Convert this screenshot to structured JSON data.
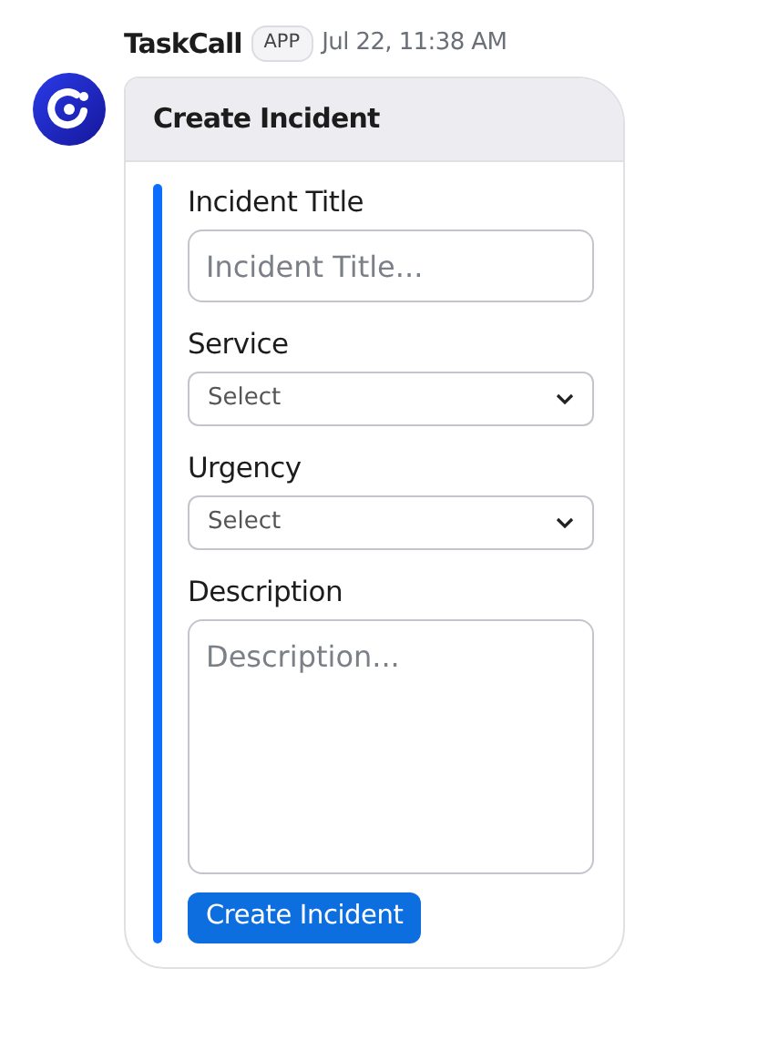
{
  "message": {
    "sender": "TaskCall",
    "badge": "APP",
    "time": "Jul 22, 11:38 AM"
  },
  "card": {
    "title": "Create Incident",
    "fields": [
      {
        "kind": "text",
        "label": "Incident Title",
        "placeholder": "Incident Title..."
      },
      {
        "kind": "select",
        "label": "Service",
        "value": "Select"
      },
      {
        "kind": "select",
        "label": "Urgency",
        "value": "Select"
      },
      {
        "kind": "textarea",
        "label": "Description",
        "placeholder": "Description..."
      }
    ],
    "button": "Create Incident"
  }
}
